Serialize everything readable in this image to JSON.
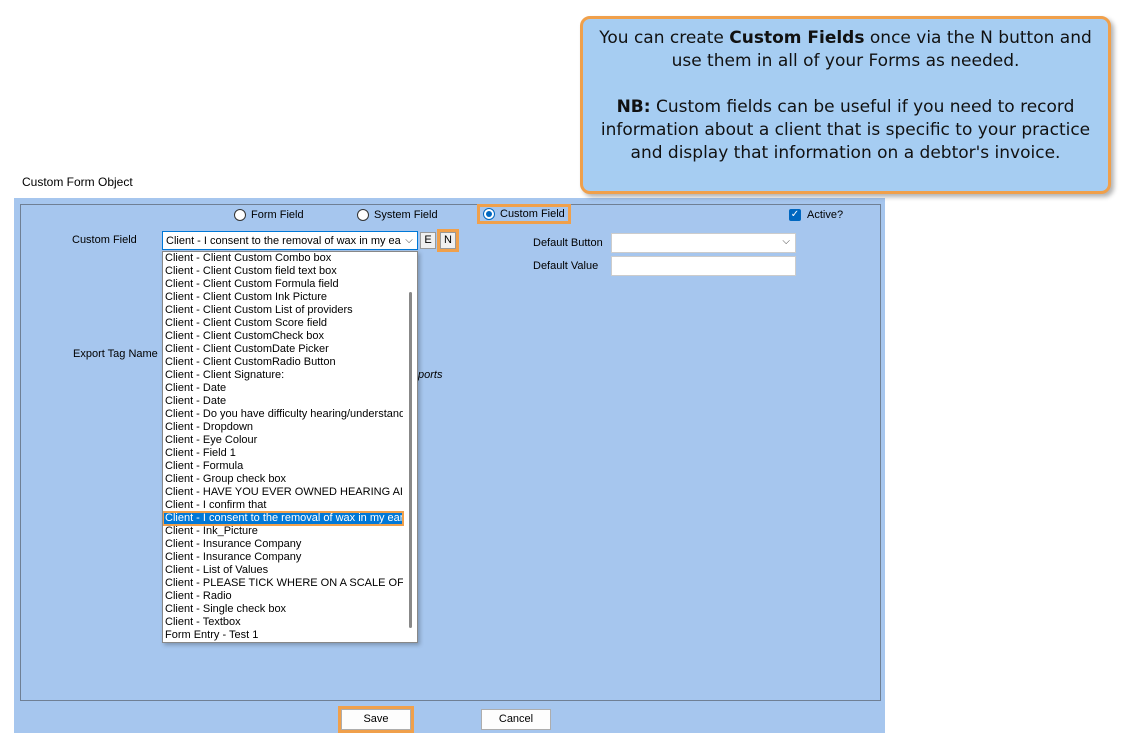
{
  "window": {
    "title": "Custom Form Object"
  },
  "radios": {
    "form_field": "Form Field",
    "system_field": "System Field",
    "custom_field": "Custom Field",
    "selected": "custom_field"
  },
  "active": {
    "label": "Active?",
    "checked": true
  },
  "custom_field": {
    "label": "Custom Field",
    "selected_value": "Client - I consent to the removal of wax in my ear(s",
    "edit_button": "E",
    "new_button": "N"
  },
  "default_button": {
    "label": "Default Button",
    "value": ""
  },
  "default_value": {
    "label": "Default Value",
    "value": ""
  },
  "export_tag": {
    "label": "Export Tag Name",
    "hidden_fragment": "ports"
  },
  "dropdown": {
    "items": [
      "Client - Client Custom Combo  box",
      "Client - Client Custom field text box",
      "Client - Client Custom Formula  field",
      "Client - Client Custom Ink Picture",
      "Client - Client Custom List of providers",
      "Client - Client Custom Score field",
      "Client - Client CustomCheck  box",
      "Client - Client CustomDate Picker",
      "Client - Client CustomRadio Button",
      "Client - Client Signature:",
      "Client - Date",
      "Client - Date",
      "Client - Do you have difficulty hearing/understand",
      "Client - Dropdown",
      "Client - Eye Colour",
      "Client - Field 1",
      "Client - Formula",
      "Client - Group check box",
      "Client - HAVE YOU EVER OWNED HEARING AI",
      "Client - I confirm that",
      "Client - I consent to the removal of wax in my ear(s",
      "Client - Ink_Picture",
      "Client - Insurance Company",
      "Client - Insurance Company",
      "Client - List of Values",
      "Client - PLEASE TICK WHERE ON A SCALE OF",
      "Client - Radio",
      "Client - Single check box",
      "Client - Textbox",
      "Form Entry - Test 1"
    ],
    "selected_index": 20
  },
  "buttons": {
    "save": "Save",
    "cancel": "Cancel"
  },
  "tooltip": {
    "line1_pre": "You can create ",
    "line1_bold": "Custom Fields",
    "line1_post": " once via the N button and use them in all of your Forms as needed.",
    "nb_bold": "NB:",
    "nb_text": " Custom fields can be useful if you need to record information about a client that is specific to your practice and display that information on a debtor's invoice."
  },
  "colors": {
    "dialog_bg": "#a6c6ee",
    "highlight": "#f0a04b",
    "selection": "#0078d7",
    "tooltip_bg": "#a6cdf2"
  }
}
